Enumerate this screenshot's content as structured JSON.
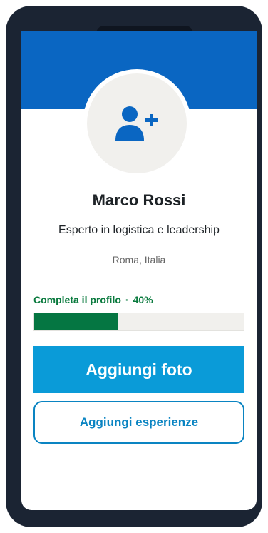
{
  "profile": {
    "name": "Marco Rossi",
    "headline": "Esperto in logistica e leadership",
    "location": "Roma, Italia",
    "avatar_icon": "add-user-icon"
  },
  "progress": {
    "label": "Completa il profilo",
    "separator": "·",
    "percent_text": "40%",
    "value": 0.4
  },
  "actions": {
    "primary_label": "Aggiungi foto",
    "secondary_label": "Aggiungi esperienze"
  },
  "colors": {
    "banner": "#0a66c2",
    "primary_button": "#0a9bd8",
    "secondary_outline": "#0a84c2",
    "progress_fill": "#057642",
    "progress_text": "#0a7a3e",
    "icon": "#0a66c2",
    "device_frame": "#1b2433"
  }
}
